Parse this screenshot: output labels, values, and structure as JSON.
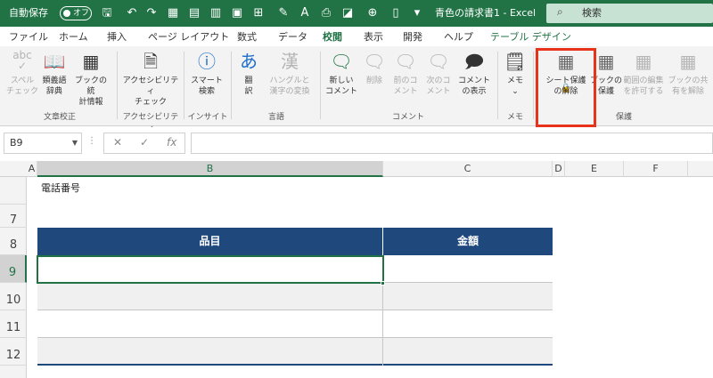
{
  "titlebar": {
    "autosave_label": "自動保存",
    "autosave_state": "オフ",
    "doc_title": "青色の請求書1 - Excel",
    "search_placeholder": "検索",
    "qat_icons": [
      "save-icon",
      "undo-icon",
      "redo-icon",
      "chart-icon",
      "table-icon",
      "pivot-icon",
      "paste-icon",
      "format-icon",
      "spell-icon",
      "text-icon",
      "print-icon",
      "new-doc-icon",
      "dropdown-icon"
    ]
  },
  "tabs": [
    {
      "label": "ファイル"
    },
    {
      "label": "ホーム"
    },
    {
      "label": "挿入"
    },
    {
      "label": "ページ レイアウト"
    },
    {
      "label": "数式"
    },
    {
      "label": "データ"
    },
    {
      "label": "校閲"
    },
    {
      "label": "表示"
    },
    {
      "label": "開発"
    },
    {
      "label": "ヘルプ"
    },
    {
      "label": "テーブル デザイン"
    }
  ],
  "active_tab": "校閲",
  "ribbon": {
    "buttons": [
      {
        "label1": "スペル",
        "label2": "チェック",
        "icon": "abc",
        "enabled": false
      },
      {
        "label1": "類義語",
        "label2": "辞典",
        "icon": "book-icon",
        "enabled": true
      },
      {
        "label1": "ブックの統",
        "label2": "計情報",
        "icon": "stats-icon",
        "enabled": true
      },
      {
        "label1": "アクセシビリティ",
        "label2": "チェック",
        "icon": "accessibility-icon",
        "enabled": true
      },
      {
        "label1": "スマート",
        "label2": "検索",
        "icon": "info-icon",
        "enabled": true
      },
      {
        "label1": "翻",
        "label2": "訳",
        "icon": "translate-icon",
        "enabled": true
      },
      {
        "label1": "ハングルと",
        "label2": "漢字の変換",
        "icon": "kanji-icon",
        "enabled": false
      },
      {
        "label1": "新しい",
        "label2": "コメント",
        "icon": "new-comment-icon",
        "enabled": true
      },
      {
        "label1": "削除",
        "label2": "",
        "icon": "delete-comment-icon",
        "enabled": false
      },
      {
        "label1": "前のコ",
        "label2": "メント",
        "icon": "prev-comment-icon",
        "enabled": false
      },
      {
        "label1": "次のコ",
        "label2": "メント",
        "icon": "next-comment-icon",
        "enabled": false
      },
      {
        "label1": "コメント",
        "label2": "の表示",
        "icon": "show-comments-icon",
        "enabled": true
      },
      {
        "label1": "メモ",
        "label2": "⌄",
        "icon": "memo-icon",
        "enabled": true
      },
      {
        "label1": "シート保護",
        "label2": "の解除",
        "icon": "unprotect-sheet-icon",
        "enabled": true
      },
      {
        "label1": "ブックの",
        "label2": "保護",
        "icon": "protect-book-icon",
        "enabled": true
      },
      {
        "label1": "範囲の編集",
        "label2": "を許可する",
        "icon": "allow-edit-icon",
        "enabled": false
      },
      {
        "label1": "ブックの共",
        "label2": "有を解除",
        "icon": "unshare-icon",
        "enabled": false
      }
    ],
    "groups": [
      "文章校正",
      "アクセシビリティ",
      "インサイト",
      "言語",
      "コメント",
      "メモ",
      "保護"
    ]
  },
  "formula_bar": {
    "name_box": "B9",
    "cancel": "✕",
    "confirm": "✓",
    "fx": "fx",
    "value": ""
  },
  "sheet": {
    "columns": [
      "A",
      "B",
      "C",
      "D",
      "E",
      "F"
    ],
    "rows": [
      "",
      "7",
      "8",
      "9",
      "10",
      "11",
      "12"
    ],
    "active_cell": "B9",
    "phone_label": "電話番号",
    "table_headers": [
      "品目",
      "金額"
    ]
  },
  "colors": {
    "brand": "#217346",
    "table_header": "#1f497d",
    "highlight": "#e8321c"
  }
}
